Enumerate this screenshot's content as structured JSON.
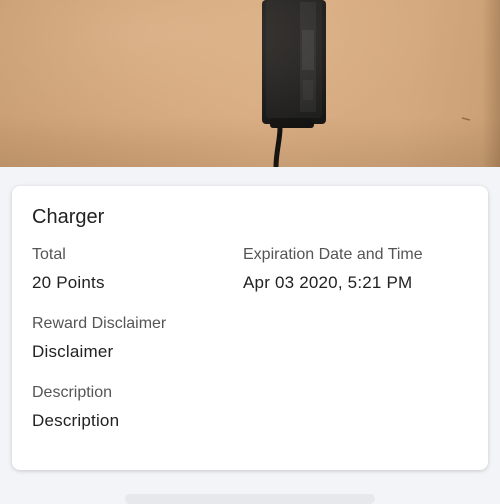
{
  "reward": {
    "title": "Charger",
    "total_label": "Total",
    "total_value": "20 Points",
    "expiration_label": "Expiration Date and Time",
    "expiration_value": "Apr 03 2020, 5:21 PM",
    "disclaimer_label": "Reward Disclaimer",
    "disclaimer_value": "Disclaimer",
    "description_label": "Description",
    "description_value": "Description"
  },
  "colors": {
    "background": "#f2f4f8",
    "card": "#ffffff",
    "text_primary": "#222222",
    "text_secondary": "#555555"
  }
}
